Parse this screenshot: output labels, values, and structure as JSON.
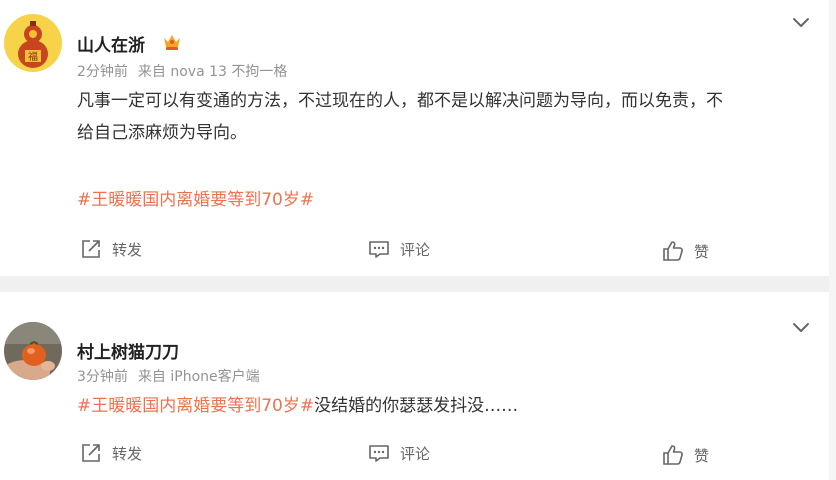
{
  "posts": [
    {
      "user": {
        "name": "山人在浙",
        "avatar_icon": "gourd-fu-avatar",
        "badge_icon": "crown-badge-icon"
      },
      "meta": {
        "time": "2分钟前",
        "source": "来自 nova 13 不拘一格"
      },
      "content": {
        "line1": "凡事一定可以有变通的方法，不过现在的人，都不是以解决问题为导向，而以免责，不",
        "line2": "给自己添麻烦为导向。",
        "topic": "#王暖暖国内离婚要等到70岁#"
      },
      "actions": {
        "repost": "转发",
        "comment": "评论",
        "like": "赞"
      }
    },
    {
      "user": {
        "name": "村上树猫刀刀",
        "avatar_icon": "persimmon-hand-avatar"
      },
      "meta": {
        "time": "3分钟前",
        "source": "来自 iPhone客户端"
      },
      "content": {
        "topic": "#王暖暖国内离婚要等到70岁#",
        "text": "没结婚的你瑟瑟发抖没……"
      },
      "actions": {
        "repost": "转发",
        "comment": "评论",
        "like": "赞"
      }
    }
  ],
  "colors": {
    "topic": "#eb7350",
    "meta": "#939393",
    "background": "#f0f0f0",
    "card": "#ffffff"
  }
}
